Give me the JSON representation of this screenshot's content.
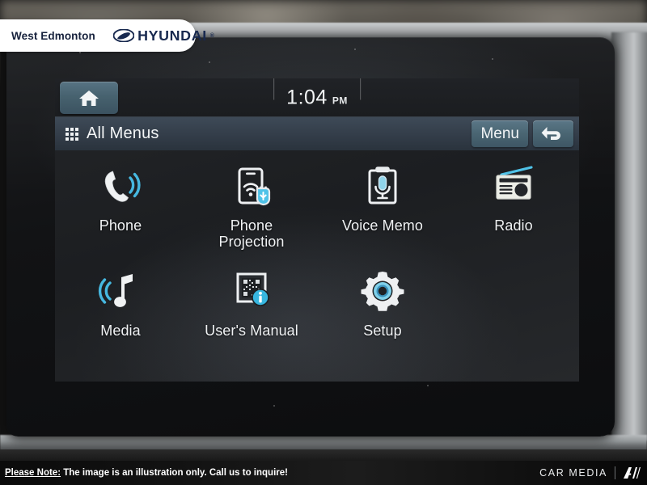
{
  "badge": {
    "dealer_name": "West Edmonton",
    "brand_mark": "hyundai-logo-icon",
    "brand_word": "HYUNDAI",
    "registered_mark": "®"
  },
  "screen": {
    "status_bar": {
      "home_button_label": "home-icon",
      "clock_time": "1:04",
      "clock_ampm": "PM"
    },
    "title_bar": {
      "grid_icon": "apps-grid-icon",
      "title": "All Menus",
      "menu_button_label": "Menu",
      "back_button_label": "back-arrow-icon"
    },
    "menu_items": [
      {
        "label": "Phone",
        "icon": "phone-handset-icon"
      },
      {
        "label": "Phone\nProjection",
        "label_line1": "Phone",
        "label_line2": "Projection",
        "icon": "phone-projection-icon"
      },
      {
        "label": "Voice Memo",
        "icon": "voice-memo-clipboard-icon"
      },
      {
        "label": "Radio",
        "icon": "radio-icon"
      },
      {
        "label": "Media",
        "icon": "music-note-icon"
      },
      {
        "label": "User's Manual",
        "icon": "users-manual-qr-icon"
      },
      {
        "label": "Setup",
        "icon": "gear-icon"
      }
    ]
  },
  "footer": {
    "note_label": "Please Note:",
    "note_body": " The image is an illustration only. Call us to inquire!",
    "watermark_text": "CAR MEDIA",
    "watermark_logo": "ai-slash-logo-icon"
  },
  "colors": {
    "accent_teal": "#4a6673",
    "icon_cyan": "#29abe2",
    "icon_white": "#eef0f2",
    "screen_bg": "#1f2124",
    "titlebar_bg": "#333d49",
    "badge_navy": "#18294f"
  }
}
